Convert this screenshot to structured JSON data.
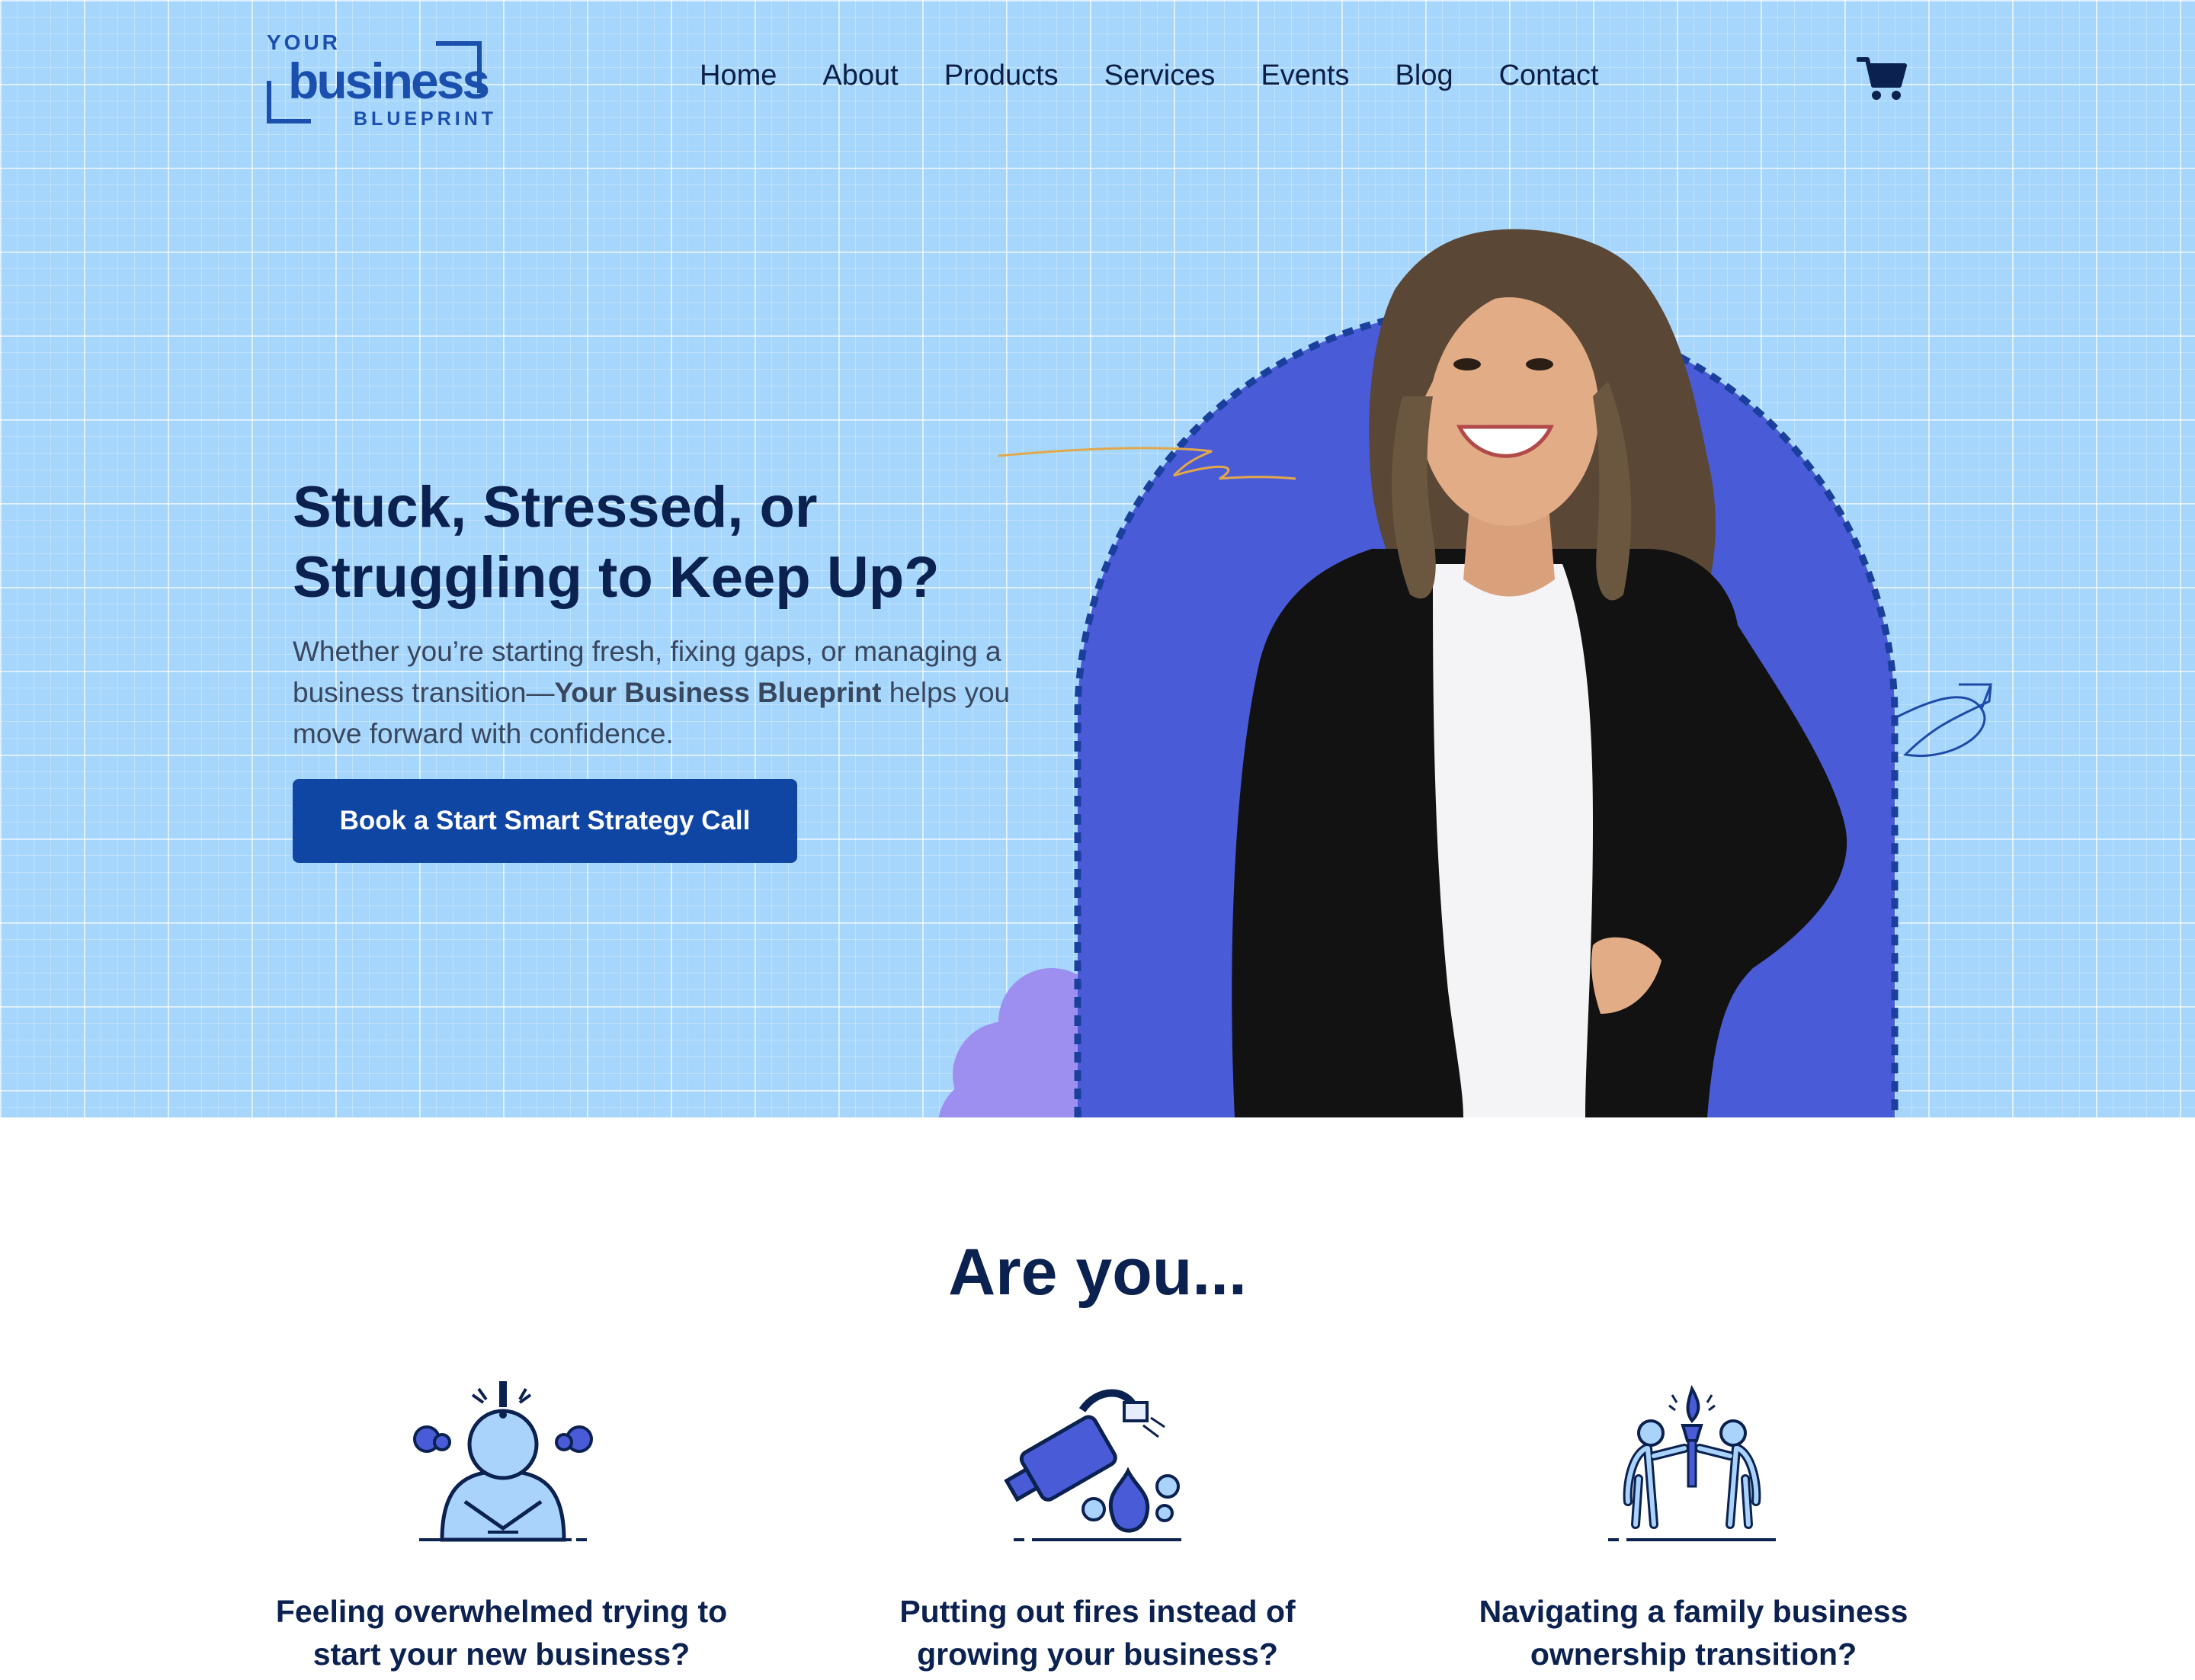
{
  "logo": {
    "line1": "YOUR",
    "line2": "business",
    "line3": "BLUEPRINT"
  },
  "nav": {
    "items": [
      "Home",
      "About",
      "Products",
      "Services",
      "Events",
      "Blog",
      "Contact"
    ],
    "cart_icon": "shopping-cart-icon"
  },
  "hero": {
    "headline_line1": "Stuck, Stressed, or",
    "headline_line2": "Struggling to Keep Up?",
    "sub_part1": "Whether you’re starting fresh, fixing gaps, or managing a business transition—",
    "sub_bold": "Your Business Blueprint",
    "sub_part2": " helps you move forward with confidence.",
    "cta_label": "Book a Start Smart Strategy Call"
  },
  "section": {
    "title": "Are you...",
    "cards": [
      {
        "icon": "overwhelmed-person-icon",
        "line1": "Feeling overwhelmed trying to",
        "line2": "start your new business?"
      },
      {
        "icon": "fire-extinguisher-icon",
        "line1": "Putting out fires instead of",
        "line2": "growing your business?"
      },
      {
        "icon": "torch-handoff-icon",
        "line1": "Navigating a family business",
        "line2": "ownership transition?"
      }
    ]
  },
  "colors": {
    "hero_bg": "#a6d6fc",
    "arch": "#4a5bd8",
    "brand_navy": "#0b2150",
    "cta": "#0f45a3",
    "blob": "#9c8ff0"
  }
}
